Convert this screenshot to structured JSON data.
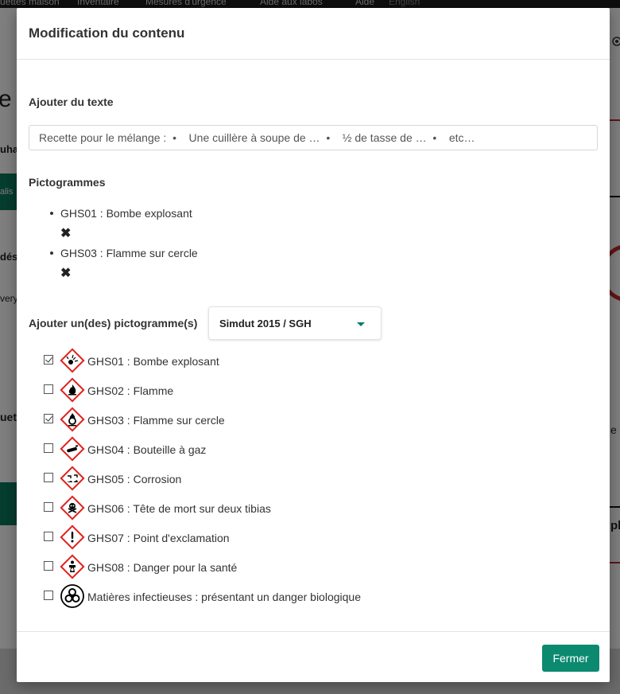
{
  "background": {
    "nav_items": [
      "uettes maison",
      "Inventaire",
      "Mesures d'urgence",
      "Aide aux labos",
      "Aide",
      "English"
    ],
    "fragments": [
      "e",
      "uha",
      "alis",
      "dés",
      "very",
      "uet",
      "e",
      "pl"
    ]
  },
  "modal": {
    "title": "Modification du contenu",
    "add_text_label": "Ajouter du texte",
    "text_input_value": "Recette pour le mélange :  •    Une cuillère à soupe de …  •    ½ de tasse de …  •    etc…",
    "pictograms_label": "Pictogrammes",
    "selected_pictograms": [
      {
        "name": "GHS01 : Bombe explosant",
        "remove_icon": "✖"
      },
      {
        "name": "GHS03 : Flamme sur cercle",
        "remove_icon": "✖"
      }
    ],
    "add_pictograms_label": "Ajouter un(des) pictogramme(s)",
    "standard_select": {
      "value": "Simdut 2015 / SGH"
    },
    "choices": [
      {
        "label": "GHS01 : Bombe explosant",
        "checked": true,
        "icon": "ghs01-exploding-bomb-icon"
      },
      {
        "label": "GHS02 : Flamme",
        "checked": false,
        "icon": "ghs02-flame-icon"
      },
      {
        "label": "GHS03 : Flamme sur cercle",
        "checked": true,
        "icon": "ghs03-flame-over-circle-icon"
      },
      {
        "label": "GHS04 : Bouteille à gaz",
        "checked": false,
        "icon": "ghs04-gas-cylinder-icon"
      },
      {
        "label": "GHS05 : Corrosion",
        "checked": false,
        "icon": "ghs05-corrosion-icon"
      },
      {
        "label": "GHS06 : Tête de mort sur deux tibias",
        "checked": false,
        "icon": "ghs06-skull-crossbones-icon"
      },
      {
        "label": "GHS07 : Point d'exclamation",
        "checked": false,
        "icon": "ghs07-exclamation-icon"
      },
      {
        "label": "GHS08 : Danger pour la santé",
        "checked": false,
        "icon": "ghs08-health-hazard-icon"
      },
      {
        "label": "Matières infectieuses : présentant un danger biologique",
        "checked": false,
        "icon": "biohazard-icon"
      }
    ],
    "close_label": "Fermer"
  },
  "colors": {
    "accent": "#0b8a70",
    "ghs_red": "#e0201b",
    "backdrop_green": "#0b7a5c"
  }
}
